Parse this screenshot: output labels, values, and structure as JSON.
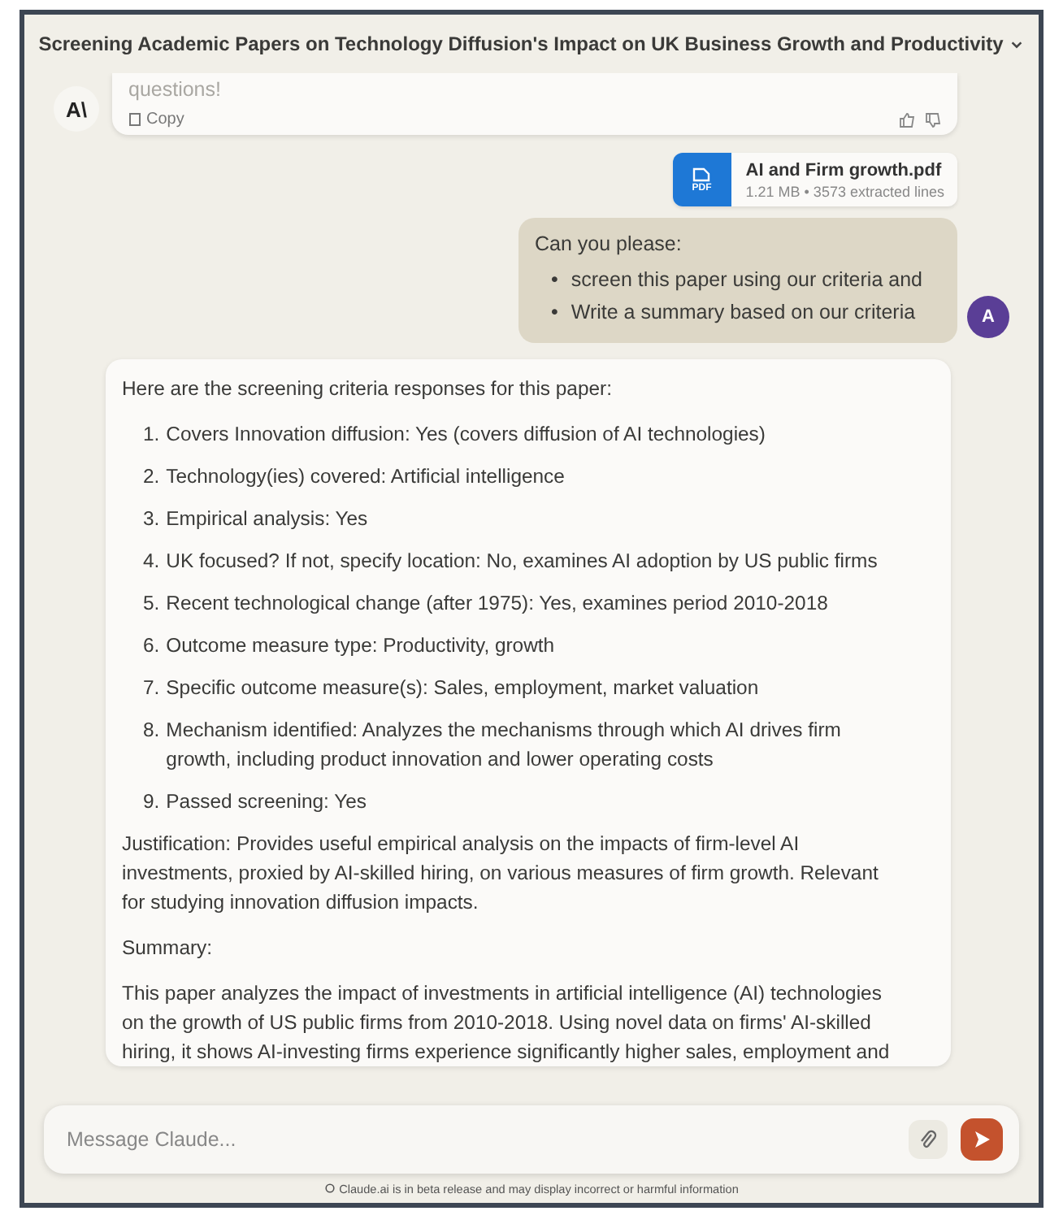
{
  "window": {
    "title": "Screening Academic Papers on Technology Diffusion's Impact on UK Business Growth and Productivity"
  },
  "previous_reply": {
    "text": "questions!",
    "copy_label": "Copy",
    "avatar": "A\\"
  },
  "attachment": {
    "name": "AI and Firm growth.pdf",
    "type_label": "PDF",
    "meta": "1.21 MB • 3573 extracted lines"
  },
  "user_message": {
    "intro": "Can you please:",
    "bullets": [
      {
        "marker": "•",
        "text": "screen this paper using our criteria and"
      },
      {
        "marker": "•",
        "text": "Write a summary based on our criteria"
      }
    ],
    "avatar": "A"
  },
  "answer": {
    "intro": "Here are the screening criteria responses for this paper:",
    "criteria": [
      {
        "number": "1.",
        "lines": [
          "Covers Innovation diffusion: Yes (covers diffusion of AI technologies)"
        ]
      },
      {
        "number": "2.",
        "lines": [
          "Technology(ies) covered: Artificial intelligence"
        ]
      },
      {
        "number": "3.",
        "lines": [
          "Empirical analysis: Yes"
        ]
      },
      {
        "number": "4.",
        "lines": [
          "UK focused? If not, specify location: No, examines AI adoption by US public firms"
        ]
      },
      {
        "number": "5.",
        "lines": [
          "Recent technological change (after 1975): Yes, examines period 2010-2018"
        ]
      },
      {
        "number": "6.",
        "lines": [
          "Outcome measure type: Productivity, growth"
        ]
      },
      {
        "number": "7.",
        "lines": [
          "Specific outcome measure(s): Sales, employment, market valuation"
        ]
      },
      {
        "number": "8.",
        "lines": [
          "Mechanism identified: Analyzes the mechanisms through which AI drives firm",
          "growth, including product innovation and lower operating costs"
        ]
      },
      {
        "number": "9.",
        "lines": [
          "Passed screening: Yes"
        ]
      }
    ],
    "justification": [
      "Justification: Provides useful empirical analysis on the impacts of firm-level AI",
      "investments, proxied by AI-skilled hiring, on various measures of firm growth. Relevant",
      "for studying innovation diffusion impacts."
    ],
    "summary_heading": "Summary:",
    "summary": [
      "This paper analyzes the impact of investments in artificial intelligence (AI) technologies",
      "on the growth of US public firms from 2010-2018. Using novel data on firms' AI-skilled",
      "hiring, it shows AI-investing firms experience significantly higher sales, employment and"
    ]
  },
  "composer": {
    "placeholder": "Message Claude..."
  },
  "footer": "Claude.ai is in beta release and may display incorrect or harmful information"
}
